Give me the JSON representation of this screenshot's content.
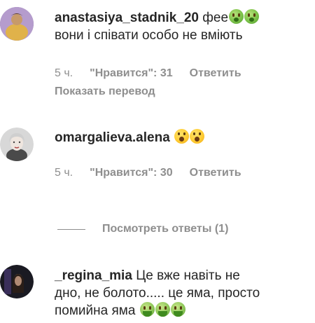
{
  "comments": [
    {
      "username": "anastasiya_stadnik_20",
      "text": "фее",
      "text_line2": "вони і співати особо не вміють",
      "emojis": [
        "green-face-icon",
        "green-face-icon"
      ],
      "time": "5 ч.",
      "likes": "\"Нравится\": 31",
      "reply": "Ответить",
      "translate": "Показать перевод"
    },
    {
      "username": "omargalieva.alena",
      "emojis": [
        "astonished-face-icon",
        "astonished-face-icon"
      ],
      "time": "5 ч.",
      "likes": "\"Нравится\": 30",
      "reply": "Ответить"
    },
    {
      "username": "_regina_mia",
      "text": "Це вже навіть не",
      "text_line2": "дно, не болото..... це яма, просто",
      "text_line3": "помийна яма",
      "emojis": [
        "vomiting-face-icon",
        "vomiting-face-icon",
        "vomiting-face-icon"
      ]
    }
  ],
  "view_replies": "Посмотреть ответы (1)",
  "colors": {
    "primary_text": "#262626",
    "secondary_text": "#8e8e8e",
    "background": "#ffffff"
  }
}
